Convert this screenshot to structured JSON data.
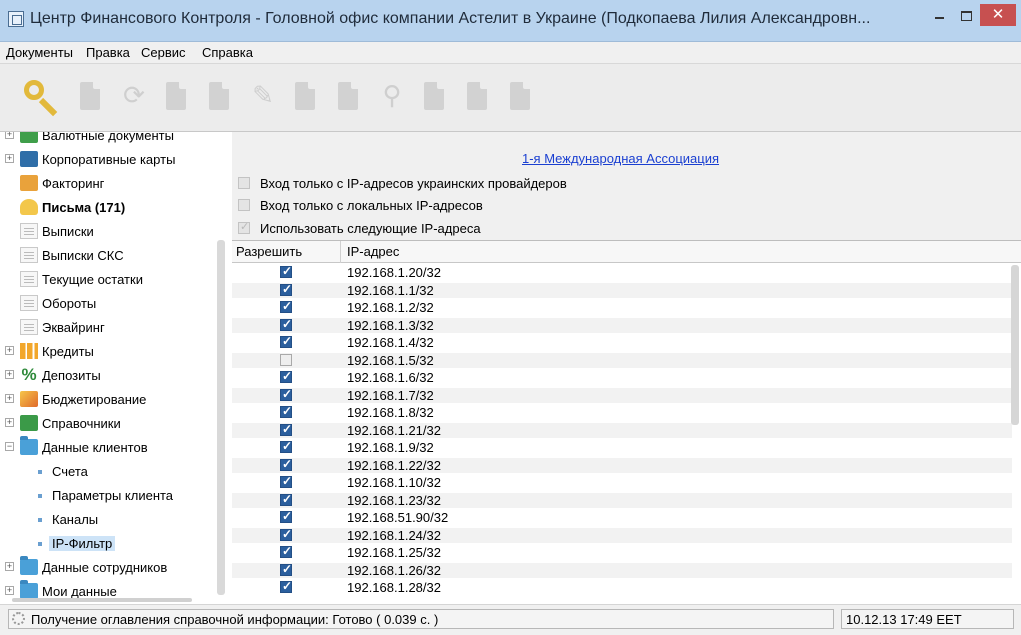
{
  "window": {
    "title": "Центр Финансового Контроля - Головной офис компании Астелит в Украине (Подкопаева Лилия Александровн...",
    "close_glyph": "✕"
  },
  "menu": [
    {
      "label": "Документы"
    },
    {
      "label": "Правка"
    },
    {
      "label": "Сервис"
    },
    {
      "label": "Справка"
    }
  ],
  "toolbar": {
    "buttons": [
      {
        "icon": "key-icon"
      },
      {
        "icon": "new-document-icon"
      },
      {
        "icon": "refresh-icon"
      },
      {
        "icon": "delete-icon"
      },
      {
        "icon": "document-icon"
      },
      {
        "icon": "edit-icon"
      },
      {
        "icon": "copy-icon"
      },
      {
        "icon": "print-icon"
      },
      {
        "icon": "search-icon"
      },
      {
        "icon": "import-icon"
      },
      {
        "icon": "export-icon"
      },
      {
        "icon": "archive-icon"
      }
    ]
  },
  "sidebar": {
    "items": [
      {
        "label": "Валютные документы",
        "icon": "money-icon",
        "expander": "+"
      },
      {
        "label": "Корпоративные карты",
        "icon": "cards-icon",
        "expander": "+"
      },
      {
        "label": "Факторинг",
        "icon": "factoring-icon",
        "expander": ""
      },
      {
        "label": "Письма (171)",
        "icon": "letters-icon",
        "expander": "",
        "bold": true
      },
      {
        "label": "Выписки",
        "icon": "document-icon",
        "expander": ""
      },
      {
        "label": "Выписки СКС",
        "icon": "document-icon",
        "expander": ""
      },
      {
        "label": "Текущие остатки",
        "icon": "document-icon",
        "expander": ""
      },
      {
        "label": "Обороты",
        "icon": "document-icon",
        "expander": ""
      },
      {
        "label": "Эквайринг",
        "icon": "document-icon",
        "expander": ""
      },
      {
        "label": "Кредиты",
        "icon": "credit-icon",
        "expander": "+"
      },
      {
        "label": "Депозиты",
        "icon": "percent-icon",
        "expander": "+"
      },
      {
        "label": "Бюджетирование",
        "icon": "budget-icon",
        "expander": "+"
      },
      {
        "label": "Справочники",
        "icon": "reference-icon",
        "expander": "+"
      },
      {
        "label": "Данные клиентов",
        "icon": "folder-icon",
        "expander": "−"
      },
      {
        "label": "Счета",
        "icon": "bullet-icon",
        "child": true
      },
      {
        "label": "Параметры клиента",
        "icon": "bullet-icon",
        "child": true
      },
      {
        "label": "Каналы",
        "icon": "bullet-icon",
        "child": true
      },
      {
        "label": "IP-Фильтр",
        "icon": "bullet-icon",
        "child": true,
        "selected": true
      },
      {
        "label": "Данные сотрудников",
        "icon": "folder-icon",
        "expander": "+"
      },
      {
        "label": "Мои данные",
        "icon": "folder-icon",
        "expander": "+"
      }
    ]
  },
  "main": {
    "organization_link": "1-я Международная Ассоциация",
    "options": [
      {
        "label": "Вход только с IP-адресов украинских провайдеров",
        "checked": false
      },
      {
        "label": "Вход только с локальных IP-адресов",
        "checked": false
      },
      {
        "label": "Использовать следующие IP-адреса",
        "checked": true
      }
    ],
    "table": {
      "columns": [
        "Разрешить",
        "IP-адрес"
      ],
      "rows": [
        {
          "allow": true,
          "ip": "192.168.1.20/32"
        },
        {
          "allow": true,
          "ip": "192.168.1.1/32"
        },
        {
          "allow": true,
          "ip": "192.168.1.2/32"
        },
        {
          "allow": true,
          "ip": "192.168.1.3/32"
        },
        {
          "allow": true,
          "ip": "192.168.1.4/32"
        },
        {
          "allow": false,
          "ip": "192.168.1.5/32"
        },
        {
          "allow": true,
          "ip": "192.168.1.6/32"
        },
        {
          "allow": true,
          "ip": "192.168.1.7/32"
        },
        {
          "allow": true,
          "ip": "192.168.1.8/32"
        },
        {
          "allow": true,
          "ip": "192.168.1.21/32"
        },
        {
          "allow": true,
          "ip": "192.168.1.9/32"
        },
        {
          "allow": true,
          "ip": "192.168.1.22/32"
        },
        {
          "allow": true,
          "ip": "192.168.1.10/32"
        },
        {
          "allow": true,
          "ip": "192.168.1.23/32"
        },
        {
          "allow": true,
          "ip": "192.168.51.90/32"
        },
        {
          "allow": true,
          "ip": "192.168.1.24/32"
        },
        {
          "allow": true,
          "ip": "192.168.1.25/32"
        },
        {
          "allow": true,
          "ip": "192.168.1.26/32"
        },
        {
          "allow": true,
          "ip": "192.168.1.28/32"
        }
      ]
    }
  },
  "statusbar": {
    "message": "Получение оглавления справочной информации: Готово ( 0.039 с. )",
    "datetime": "10.12.13 17:49 EET"
  },
  "colors": {
    "titlebar": "#b8d3ee",
    "close_button": "#c75050",
    "link": "#1a3fd1",
    "checkbox_on": "#2b5f9e",
    "selection": "#cde3f7"
  }
}
